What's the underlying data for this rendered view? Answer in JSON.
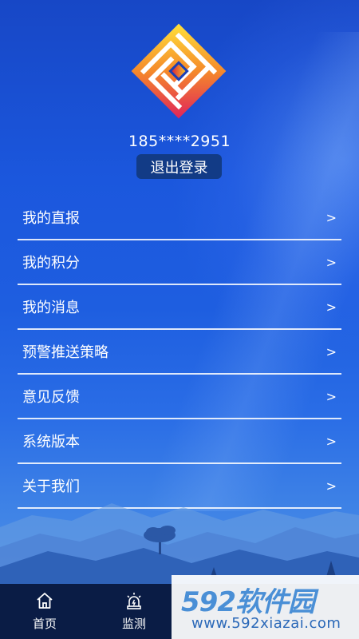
{
  "profile": {
    "phone": "185****2951",
    "logout_label": "退出登录"
  },
  "menu": {
    "items": [
      {
        "label": "我的直报",
        "chevron": ">"
      },
      {
        "label": "我的积分",
        "chevron": ">"
      },
      {
        "label": "我的消息",
        "chevron": ">"
      },
      {
        "label": "预警推送策略",
        "chevron": ">"
      },
      {
        "label": "意见反馈",
        "chevron": ">"
      },
      {
        "label": "系统版本",
        "chevron": ">"
      },
      {
        "label": "关于我们",
        "chevron": ">"
      }
    ]
  },
  "tabbar": {
    "tabs": [
      {
        "label": "首页",
        "icon": "home-icon"
      },
      {
        "label": "监测",
        "icon": "alarm-icon"
      }
    ]
  },
  "watermark": {
    "brand": "592软件园",
    "url": "www.592xiazai.com"
  }
}
